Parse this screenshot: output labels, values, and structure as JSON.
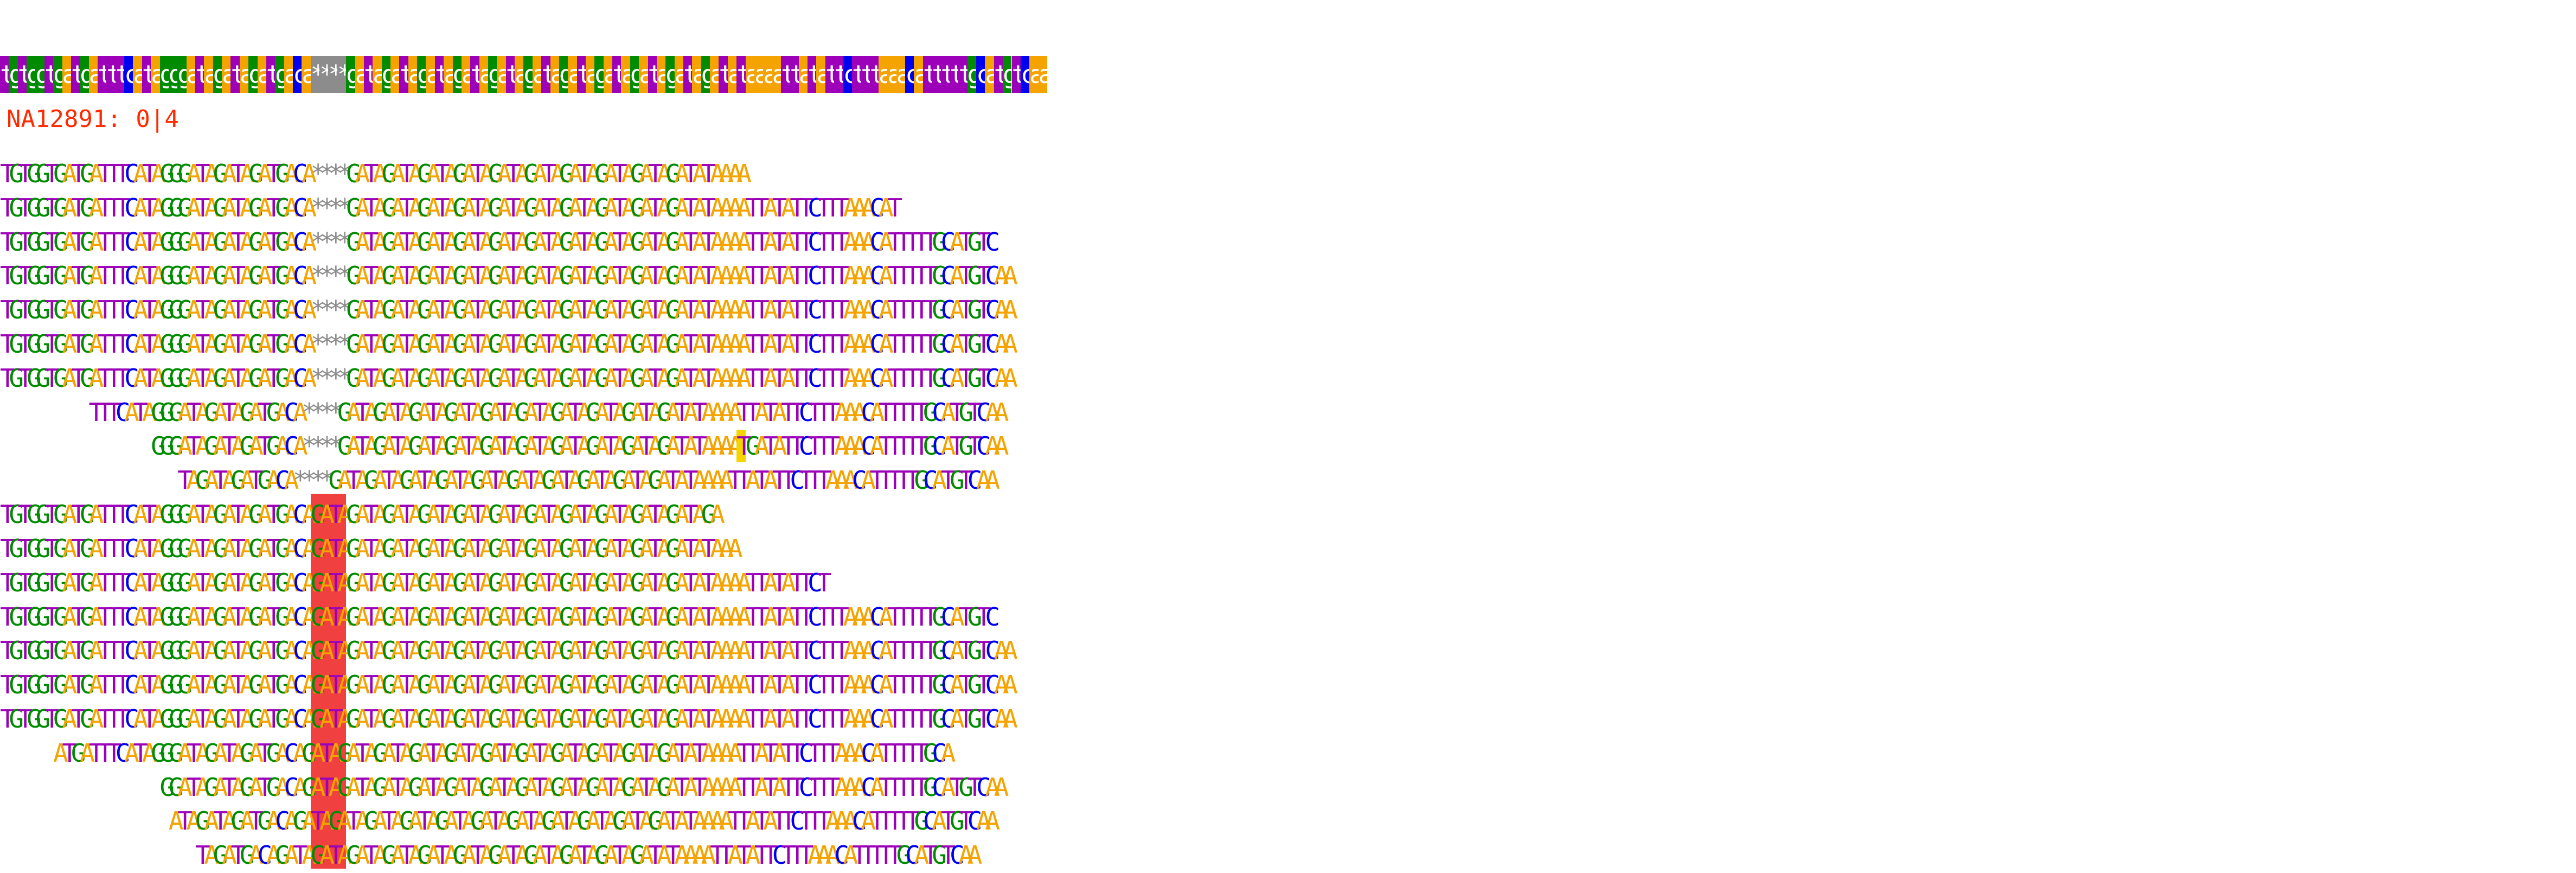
{
  "colors": {
    "A": "#f5a300",
    "T": "#9c00b8",
    "G": "#008b00",
    "C": "#0000f0",
    "gap": "#8c8c8c",
    "insertion_highlight": "#f04040",
    "mismatch_highlight": "#f5d400",
    "sample_label": "#ff2a00"
  },
  "reference": "tgtggtgatgatttcatagggatagatagatgaca****gatagatagatagatagatagatagatagatagatagatagatataaaattatattctttaaacatttttgcatgtcaa",
  "sample": {
    "label": "NA12891: 0|4"
  },
  "reads": [
    {
      "offset": 0,
      "seq": "TGTGGTGATGATTTCATAGGGATAGATAGATGACA****GATAGATAGATAGATAGATAGATAGATAGATAGATAGATATAAAA"
    },
    {
      "offset": 0,
      "seq": "TGTGGTGATGATTTCATAGGGATAGATAGATGACA****GATAGATAGATAGATAGATAGATAGATAGATAGATAGATATAAAATTATATTCTTTAAACAT"
    },
    {
      "offset": 0,
      "seq": "TGTGGTGATGATTTCATAGGGATAGATAGATGACA****GATAGATAGATAGATAGATAGATAGATAGATAGATAGATATAAAATTATATTCTTTAAACATTTTTGCATGTC"
    },
    {
      "offset": 0,
      "seq": "TGTGGTGATGATTTCATAGGGATAGATAGATGACA****GATAGATAGATAGATAGATAGATAGATAGATAGATAGATATAAAATTATATTCTTTAAACATTTTTGCATGTCAA"
    },
    {
      "offset": 0,
      "seq": "TGTGGTGATGATTTCATAGGGATAGATAGATGACA****GATAGATAGATAGATAGATAGATAGATAGATAGATAGATATAAAATTATATTCTTTAAACATTTTTGCATGTCAA"
    },
    {
      "offset": 0,
      "seq": "TGTGGTGATGATTTCATAGGGATAGATAGATGACA****GATAGATAGATAGATAGATAGATAGATAGATAGATAGATATAAAATTATATTCTTTAAACATTTTTGCATGTCAA"
    },
    {
      "offset": 0,
      "seq": "TGTGGTGATGATTTCATAGGGATAGATAGATGACA****GATAGATAGATAGATAGATAGATAGATAGATAGATAGATATAAAATTATATTCTTTAAACATTTTTGCATGTCAA"
    },
    {
      "offset": 10,
      "seq": "TTTCATAGGGATAGATAGATGACA****GATAGATAGATAGATAGATAGATAGATAGATAGATAGATATAAAATTATATTCTTTAAACATTTTTGCATGTCAA"
    },
    {
      "offset": 17,
      "seq": "GGGATAGATAGATGACA****GATAGATAGATAGATAGATAGATAGATAGATAGATAGATATAAAATGATATTCTTTAAACATTTTTGCATGTCAA",
      "mismatch": [
        83
      ]
    },
    {
      "offset": 20,
      "seq": "TAGATAGATGACA****GATAGATAGATAGATAGATAGATAGATAGATAGATAGATATAAAATTATATTCTTTAAACATTTTTGCATGTCAA"
    },
    {
      "offset": 0,
      "seq": "TGTGGTGATGATTTCATAGGGATAGATAGATGACAGATAGATAGATAGATAGATAGATAGATAGATAGATAGATAGATAGA",
      "ins": true
    },
    {
      "offset": 0,
      "seq": "TGTGGTGATGATTTCATAGGGATAGATAGATGACAGATAGATAGATAGATAGATAGATAGATAGATAGATAGATAGATATAAA",
      "ins": true
    },
    {
      "offset": 0,
      "seq": "TGTGGTGATGATTTCATAGGGATAGATAGATGACAGATAGATAGATAGATAGATAGATAGATAGATAGATAGATAGATATAAAATTATATTCT",
      "ins": true
    },
    {
      "offset": 0,
      "seq": "TGTGGTGATGATTTCATAGGGATAGATAGATGACAGATAGATAGATAGATAGATAGATAGATAGATAGATAGATAGATATAAAATTATATTCTTTAAACATTTTTGCATGTC",
      "ins": true
    },
    {
      "offset": 0,
      "seq": "TGTGGTGATGATTTCATAGGGATAGATAGATGACAGATAGATAGATAGATAGATAGATAGATAGATAGATAGATAGATATAAAATTATATTCTTTAAACATTTTTGCATGTCAA",
      "ins": true
    },
    {
      "offset": 0,
      "seq": "TGTGGTGATGATTTCATAGGGATAGATAGATGACAGATAGATAGATAGATAGATAGATAGATAGATAGATAGATAGATATAAAATTATATTCTTTAAACATTTTTGCATGTCAA",
      "ins": true
    },
    {
      "offset": 0,
      "seq": "TGTGGTGATGATTTCATAGGGATAGATAGATGACAGATAGATAGATAGATAGATAGATAGATAGATAGATAGATAGATATAAAATTATATTCTTTAAACATTTTTGCATGTCAA",
      "ins": true
    },
    {
      "offset": 6,
      "seq": "ATGATTTCATAGGGATAGATAGATGACAGATAGATAGATAGATAGATAGATAGATAGATAGATAGATAGATATAAAATTATATTCTTTAAACATTTTTGCA",
      "ins": true
    },
    {
      "offset": 18,
      "seq": "GGATAGATAGATGACAGATAGATAGATAGATAGATAGATAGATAGATAGATAGATAGATATAAAATTATATTCTTTAAACATTTTTGCATGTCAA",
      "ins": true
    },
    {
      "offset": 19,
      "seq": "ATAGATAGATGACAGATAGATAGATAGATAGATAGATAGATAGATAGATAGATAGATATAAAATTATATTCTTTAAACATTTTTGCATGTCAA",
      "ins": true
    },
    {
      "offset": 22,
      "seq": "TAGATGACAGATAGATAGATAGATAGATAGATAGATAGATAGATAGATAGATATAAAATTATATTCTTTAAACATTTTTGCATGTCAA",
      "ins": true
    }
  ]
}
